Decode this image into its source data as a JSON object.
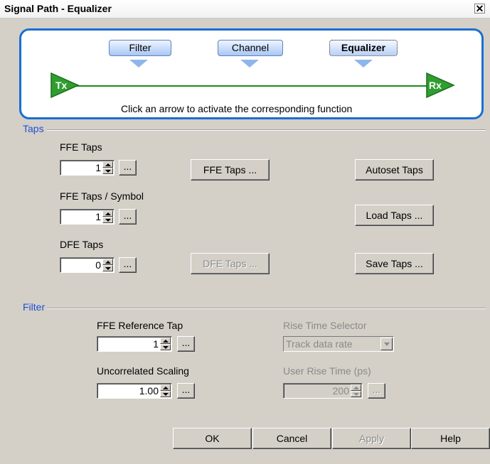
{
  "window": {
    "title": "Signal Path - Equalizer",
    "close_glyph": "✕"
  },
  "signal_path": {
    "buttons": [
      {
        "label": "Filter",
        "active": false
      },
      {
        "label": "Channel",
        "active": false
      },
      {
        "label": "Equalizer",
        "active": true
      }
    ],
    "tx_label": "Tx",
    "rx_label": "Rx",
    "hint": "Click an arrow to activate the corresponding function"
  },
  "taps": {
    "group_label": "Taps",
    "ffe_taps": {
      "label": "FFE Taps",
      "value": "1"
    },
    "ffe_taps_per_symbol": {
      "label": "FFE Taps / Symbol",
      "value": "1"
    },
    "dfe_taps": {
      "label": "DFE Taps",
      "value": "0"
    },
    "browse_label": "...",
    "ffe_taps_button": "FFE Taps ...",
    "dfe_taps_button": "DFE Taps ...",
    "autoset_button": "Autoset Taps",
    "load_button": "Load Taps ...",
    "save_button": "Save Taps ..."
  },
  "filter": {
    "group_label": "Filter",
    "ffe_reference_tap": {
      "label": "FFE Reference Tap",
      "value": "1"
    },
    "uncorrelated_scaling": {
      "label": "Uncorrelated Scaling",
      "value": "1.00"
    },
    "rise_time_selector": {
      "label": "Rise Time Selector",
      "value": "Track data rate"
    },
    "user_rise_time": {
      "label": "User Rise Time (ps)",
      "value": "200"
    },
    "browse_label": "..."
  },
  "footer": {
    "ok": "OK",
    "cancel": "Cancel",
    "apply": "Apply",
    "help": "Help"
  },
  "colors": {
    "accent": "#1a6fd3",
    "group_label": "#1f4fd6",
    "port_green": "#2f9e2f",
    "signal_line": "#1c8a1c"
  }
}
